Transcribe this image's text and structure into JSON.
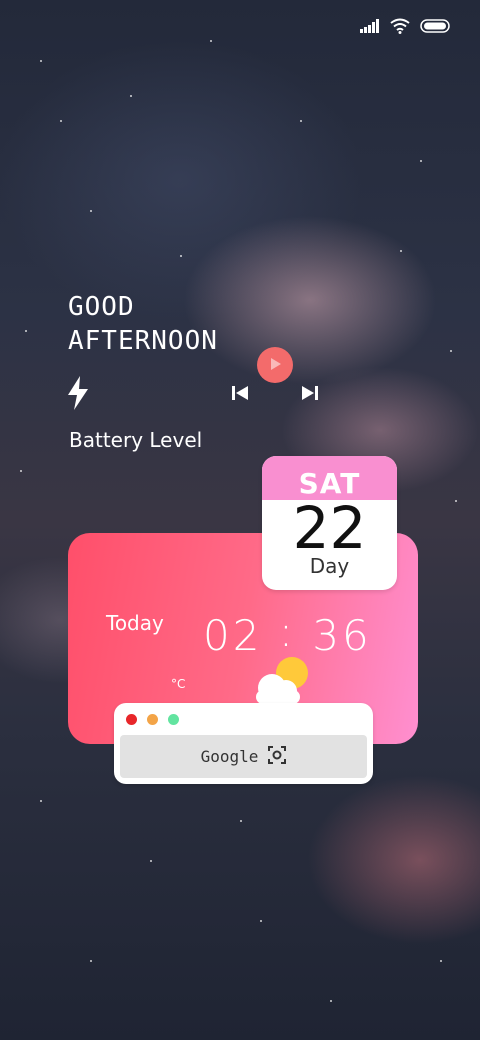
{
  "status_bar": {
    "icons": [
      "signal-icon",
      "wifi-icon",
      "battery-icon"
    ]
  },
  "greeting": {
    "line1": "GOOD",
    "line2": "AFTERNOON"
  },
  "music": {
    "icons": [
      "play-icon",
      "previous-track-icon",
      "next-track-icon"
    ],
    "accent": "#f36b6b"
  },
  "battery": {
    "label": "Battery Level",
    "icon": "lightning-bolt-icon"
  },
  "calendar": {
    "weekday": "SAT",
    "day": "22",
    "sub": "Day",
    "header_color": "#f98fd0"
  },
  "weather_card": {
    "today_label": "Today",
    "hours": "02",
    "separator": ":",
    "minutes": "36",
    "temp_unit": "°C",
    "weather_icon": "partly-cloudy-icon",
    "gradient": [
      "#ff4f6a",
      "#ff8fd0"
    ]
  },
  "browser": {
    "dot_colors": [
      "#e8262a",
      "#f3a447",
      "#62e4a0"
    ],
    "search_label": "Google",
    "search_icon": "scan-icon"
  }
}
